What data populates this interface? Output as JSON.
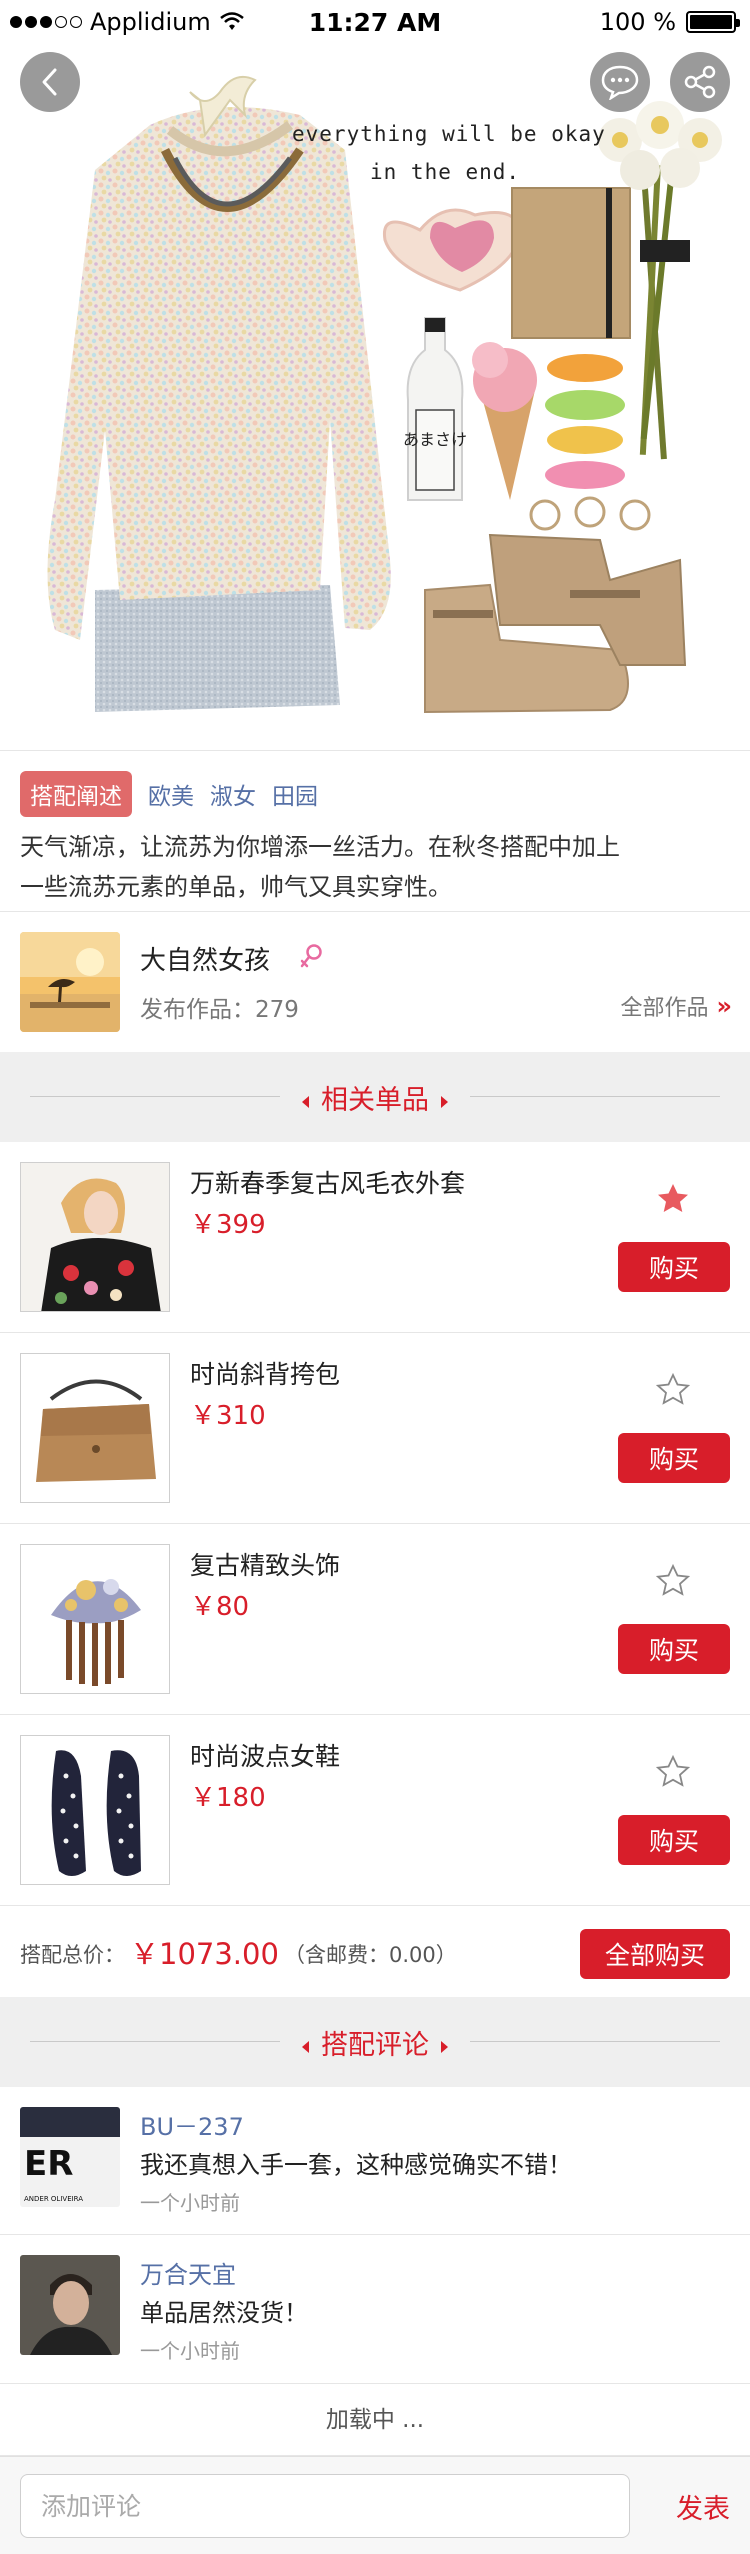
{
  "status_bar": {
    "carrier": "Applidium",
    "time": "11:27 AM",
    "battery": "100 %"
  },
  "hero": {
    "caption_line1": "everything will be okay",
    "caption_line2": "in the end.",
    "bottle_label": "あまさけ",
    "back_icon": "chevron-left-icon",
    "comment_icon": "chat-bubble-icon",
    "share_icon": "share-icon"
  },
  "description": {
    "tag_main": "搭配阐述",
    "tags": [
      "欧美",
      "淑女",
      "田园"
    ],
    "text_line1": "天气渐凉，让流苏为你增添一丝活力。在秋冬搭配中加上",
    "text_line2": "一些流苏元素的单品，帅气又具实穿性。"
  },
  "author": {
    "name": "大自然女孩",
    "works_label": "发布作品：279",
    "all_works_label": "全部作品",
    "gender_icon": "female-icon"
  },
  "related_section": {
    "title": "相关单品"
  },
  "products": [
    {
      "name": "万新春季复古风毛衣外套",
      "price": "￥399",
      "starred": true,
      "buy_label": "购买"
    },
    {
      "name": "时尚斜背挎包",
      "price": "￥310",
      "starred": false,
      "buy_label": "购买"
    },
    {
      "name": "复古精致头饰",
      "price": "￥80",
      "starred": false,
      "buy_label": "购买"
    },
    {
      "name": "时尚波点女鞋",
      "price": "￥180",
      "starred": false,
      "buy_label": "购买"
    }
  ],
  "total": {
    "label": "搭配总价：",
    "price": "￥1073.00",
    "shipping": "（含邮费：0.00）",
    "buy_all_label": "全部购买"
  },
  "comments_section": {
    "title": "搭配评论"
  },
  "comments": [
    {
      "user": "BU－237",
      "text": "我还真想入手一套，这种感觉确实不错！",
      "time": "一个小时前",
      "avatar_text": "ER",
      "avatar_caption": "ANDER OLIVEIRA"
    },
    {
      "user": "万合天宜",
      "text": "单品居然没货！",
      "time": "一个小时前"
    }
  ],
  "loading_text": "加载中 ...",
  "input": {
    "placeholder": "添加评论",
    "send_label": "发表"
  },
  "colors": {
    "accent": "#d81e2a",
    "link": "#5670a6",
    "tag_bg": "#e06a6a"
  }
}
